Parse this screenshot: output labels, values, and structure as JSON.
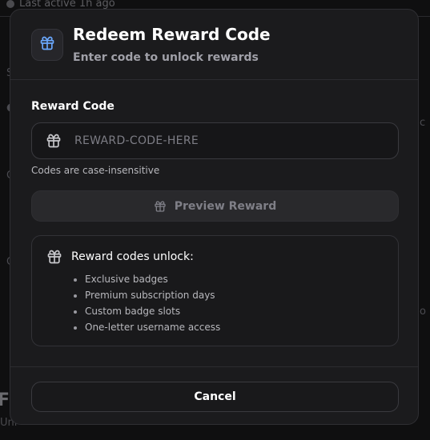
{
  "background": {
    "last_active": "Last active 1h ago",
    "section_heading": "Fe",
    "section_sub": "Uni"
  },
  "modal": {
    "title": "Redeem Reward Code",
    "subtitle": "Enter code to unlock rewards",
    "field_label": "Reward Code",
    "input_value": "",
    "input_placeholder": "REWARD-CODE-HERE",
    "hint": "Codes are case-insensitive",
    "preview_button": "Preview Reward",
    "info_title": "Reward codes unlock:",
    "info_items": [
      "Exclusive badges",
      "Premium subscription days",
      "Custom badge slots",
      "One-letter username access"
    ],
    "cancel_button": "Cancel"
  },
  "icons": {
    "header": "gift-icon",
    "input": "gift-icon",
    "preview": "gift-icon",
    "info": "gift-icon"
  },
  "colors": {
    "accent_icon": "#6aa8ff",
    "modal_bg": "#1b1b1d",
    "text_muted": "#a0a0a8"
  }
}
